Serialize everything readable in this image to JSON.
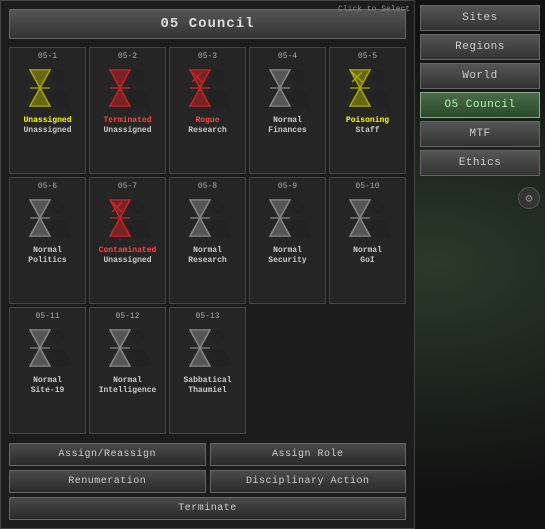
{
  "title": "05 Council",
  "agents": [
    {
      "id": "05-1",
      "status_label": "Unassigned",
      "status_line2": "Unassigned",
      "status_class": "status-unassigned",
      "id_class": "",
      "rogue": false,
      "contaminated": false,
      "poisoning": false
    },
    {
      "id": "05-2",
      "status_label": "Terminated",
      "status_line2": "Unassigned",
      "status_class": "status-terminated",
      "rogue": false,
      "contaminated": false,
      "poisoning": false
    },
    {
      "id": "05-3",
      "status_label": "Rogue",
      "status_line2": "Research",
      "status_class": "status-rogue",
      "rogue": true,
      "contaminated": false,
      "poisoning": false
    },
    {
      "id": "05-4",
      "status_label": "Normal",
      "status_line2": "Finances",
      "status_class": "status-normal",
      "rogue": false,
      "contaminated": false,
      "poisoning": false
    },
    {
      "id": "05-5",
      "status_label": "Poisoning",
      "status_line2": "Staff",
      "status_class": "status-poisoning",
      "rogue": false,
      "contaminated": false,
      "poisoning": true
    },
    {
      "id": "05-6",
      "status_label": "Normal",
      "status_line2": "Politics",
      "status_class": "status-normal",
      "rogue": false,
      "contaminated": false,
      "poisoning": false
    },
    {
      "id": "05-7",
      "status_label": "Contaminated",
      "status_line2": "Unassigned",
      "status_class": "status-contaminated",
      "rogue": false,
      "contaminated": true,
      "poisoning": false
    },
    {
      "id": "05-8",
      "status_label": "Normal",
      "status_line2": "Research",
      "status_class": "status-normal",
      "rogue": false,
      "contaminated": false,
      "poisoning": false
    },
    {
      "id": "05-9",
      "status_label": "Normal",
      "status_line2": "Security",
      "status_class": "status-normal",
      "rogue": false,
      "contaminated": false,
      "poisoning": false
    },
    {
      "id": "05-10",
      "status_label": "Normal",
      "status_line2": "GoI",
      "status_class": "status-normal",
      "rogue": false,
      "contaminated": false,
      "poisoning": false
    },
    {
      "id": "05-11",
      "status_label": "Normal",
      "status_line2": "Site-19",
      "status_class": "status-normal",
      "rogue": false,
      "contaminated": false,
      "poisoning": false
    },
    {
      "id": "05-12",
      "status_label": "Normal",
      "status_line2": "Intelligence",
      "status_class": "status-normal",
      "rogue": false,
      "contaminated": false,
      "poisoning": false
    },
    {
      "id": "05-13",
      "status_label": "Sabbatical",
      "status_line2": "Thaumiel",
      "status_class": "status-normal",
      "rogue": false,
      "contaminated": false,
      "poisoning": false
    }
  ],
  "actions": [
    {
      "label": "Assign/Reassign",
      "name": "assign-reassign-button"
    },
    {
      "label": "Assign Role",
      "name": "assign-role-button"
    },
    {
      "label": "Renumeration",
      "name": "renumeration-button"
    },
    {
      "label": "Disciplinary Action",
      "name": "disciplinary-action-button"
    },
    {
      "label": "Terminate",
      "name": "terminate-button"
    }
  ],
  "sidebar": {
    "buttons": [
      {
        "label": "Sites",
        "name": "sites-button",
        "active": false
      },
      {
        "label": "Regions",
        "name": "regions-button",
        "active": false
      },
      {
        "label": "World",
        "name": "world-button",
        "active": false
      },
      {
        "label": "O5 Council",
        "name": "o5council-button",
        "active": true
      },
      {
        "label": "MTF",
        "name": "mtf-button",
        "active": false
      },
      {
        "label": "Ethics",
        "name": "ethics-button",
        "active": false
      }
    ]
  },
  "click_hint": "Click to Select"
}
